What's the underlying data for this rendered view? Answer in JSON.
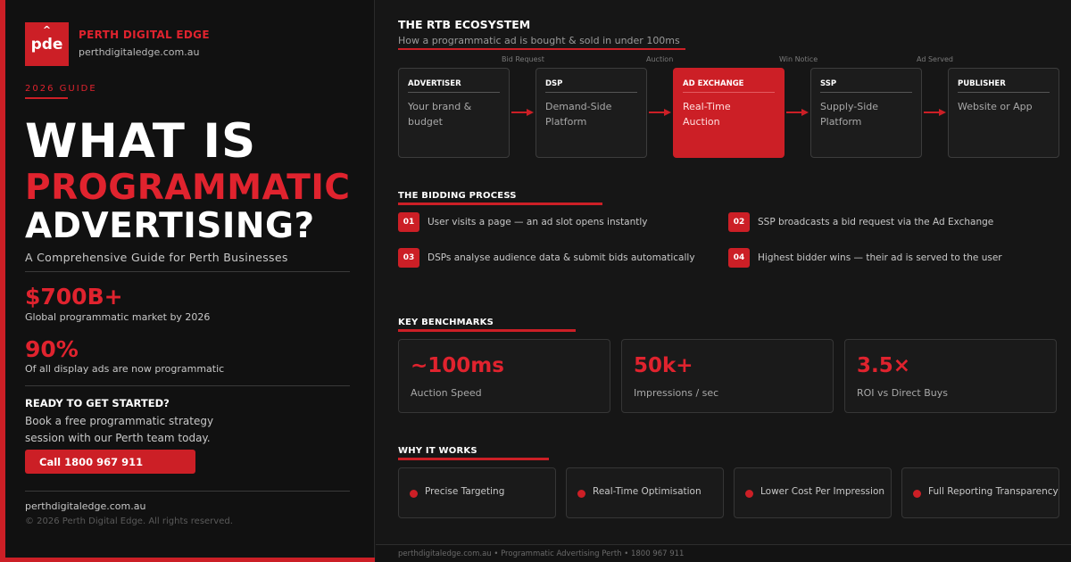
{
  "colors": {
    "accent": "#cc1f26",
    "background": "#161616",
    "panel": "#111111"
  },
  "brand": {
    "logo_caret": "^",
    "logo_text": "pde",
    "name": "PERTH DIGITAL EDGE",
    "url": "perthdigitaledge.com.au"
  },
  "hero": {
    "eyebrow": "2026 GUIDE",
    "title_line1": "WHAT IS",
    "title_line2": "PROGRAMMATIC",
    "title_line3": "ADVERTISING?",
    "subtitle": "A Comprehensive Guide for Perth Businesses"
  },
  "stats": [
    {
      "value": "$700B+",
      "label": "Global programmatic market by 2026"
    },
    {
      "value": "90%",
      "label": "Of all display ads are now programmatic"
    }
  ],
  "cta": {
    "title": "READY TO GET STARTED?",
    "text": "Book a free programmatic strategy session with our Perth team today.",
    "button": "Call 1800 967 911"
  },
  "left_footer": {
    "url": "perthdigitaledge.com.au",
    "copyright": "© 2026 Perth Digital Edge. All rights reserved."
  },
  "ecosystem": {
    "title": "THE RTB ECOSYSTEM",
    "subtitle": "How a programmatic ad is bought & sold in under 100ms",
    "step_labels": [
      "Bid Request",
      "Auction",
      "Win Notice",
      "Ad Served"
    ],
    "nodes": [
      {
        "title": "ADVERTISER",
        "desc": "Your brand & budget",
        "active": false
      },
      {
        "title": "DSP",
        "desc": "Demand-Side Platform",
        "active": false
      },
      {
        "title": "AD EXCHANGE",
        "desc": "Real-Time Auction",
        "active": true
      },
      {
        "title": "SSP",
        "desc": "Supply-Side Platform",
        "active": false
      },
      {
        "title": "PUBLISHER",
        "desc": "Website or App",
        "active": false
      }
    ]
  },
  "bidding": {
    "title": "THE BIDDING PROCESS",
    "steps": [
      {
        "num": "01",
        "text": "User visits a page — an ad slot opens instantly"
      },
      {
        "num": "02",
        "text": "SSP broadcasts a bid request via the Ad Exchange"
      },
      {
        "num": "03",
        "text": "DSPs analyse audience data & submit bids automatically"
      },
      {
        "num": "04",
        "text": "Highest bidder wins — their ad is served to the user"
      }
    ]
  },
  "benchmarks": {
    "title": "KEY BENCHMARKS",
    "items": [
      {
        "value": "~100ms",
        "label": "Auction Speed"
      },
      {
        "value": "50k+",
        "label": "Impressions / sec"
      },
      {
        "value": "3.5×",
        "label": "ROI vs Direct Buys"
      }
    ]
  },
  "why": {
    "title": "WHY IT WORKS",
    "items": [
      "Precise Targeting",
      "Real-Time Optimisation",
      "Lower Cost Per Impression",
      "Full Reporting Transparency"
    ]
  },
  "footer_bar": "perthdigitaledge.com.au  •  Programmatic Advertising Perth  •  1800 967 911"
}
